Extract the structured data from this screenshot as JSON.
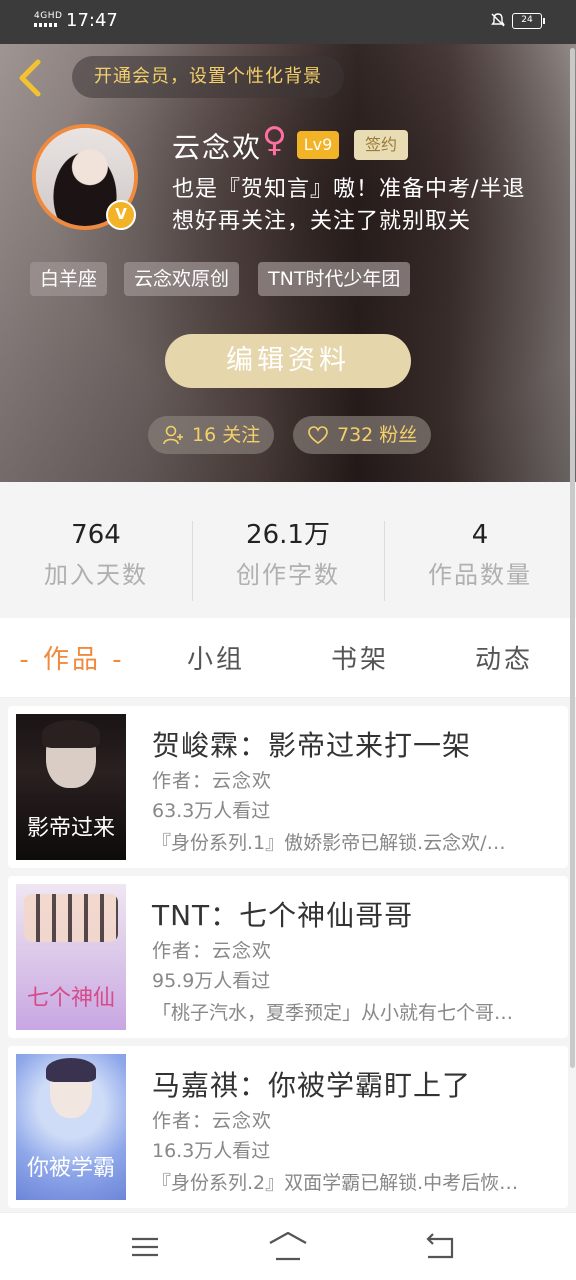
{
  "status_bar": {
    "network": "4GHD",
    "time": "17:47",
    "battery": "24"
  },
  "hero": {
    "vip_text": "开通会员，设置个性化背景",
    "username": "云念欢",
    "gender_symbol": "♀",
    "level": "Lv9",
    "signed_badge": "签约",
    "bio": "也是『贺知言』嗷！准备中考/半退 想好再关注，关注了就别取关",
    "avatar_badge": "V",
    "tags": [
      "白羊座",
      "云念欢原创",
      "TNT时代少年团"
    ],
    "edit_button": "编辑资料",
    "following": "16 关注",
    "followers": "732 粉丝"
  },
  "stats": [
    {
      "value": "764",
      "label": "加入天数"
    },
    {
      "value": "26.1万",
      "label": "创作字数"
    },
    {
      "value": "4",
      "label": "作品数量"
    }
  ],
  "tabs": [
    {
      "label": "- 作品 -",
      "active": true
    },
    {
      "label": "小组",
      "active": false
    },
    {
      "label": "书架",
      "active": false
    },
    {
      "label": "动态",
      "active": false
    }
  ],
  "books": [
    {
      "title": "贺峻霖：影帝过来打一架",
      "author": "作者：云念欢",
      "views": "63.3万人看过",
      "desc": "『身份系列.1』傲娇影帝已解锁.云念欢/…",
      "cover_text": "影帝过来"
    },
    {
      "title": "TNT：七个神仙哥哥",
      "author": "作者：云念欢",
      "views": "95.9万人看过",
      "desc": "「桃子汽水，夏季预定」从小就有七个哥…",
      "cover_text": "七个神仙"
    },
    {
      "title": "马嘉祺：你被学霸盯上了",
      "author": "作者：云念欢",
      "views": "16.3万人看过",
      "desc": "『身份系列.2』双面学霸已解锁.中考后恢…",
      "cover_text": "你被学霸"
    }
  ],
  "colors": {
    "accent": "#f08a3e",
    "gold": "#f4d06a",
    "level": "#f2b326",
    "edit_button": "#e6d6ac"
  },
  "icons": {
    "back": "chevron-left-icon",
    "bell": "bell-off-icon",
    "follow": "add-user-icon",
    "fans": "heart-icon",
    "menu": "menu-icon",
    "home": "home-icon",
    "return": "return-icon"
  }
}
